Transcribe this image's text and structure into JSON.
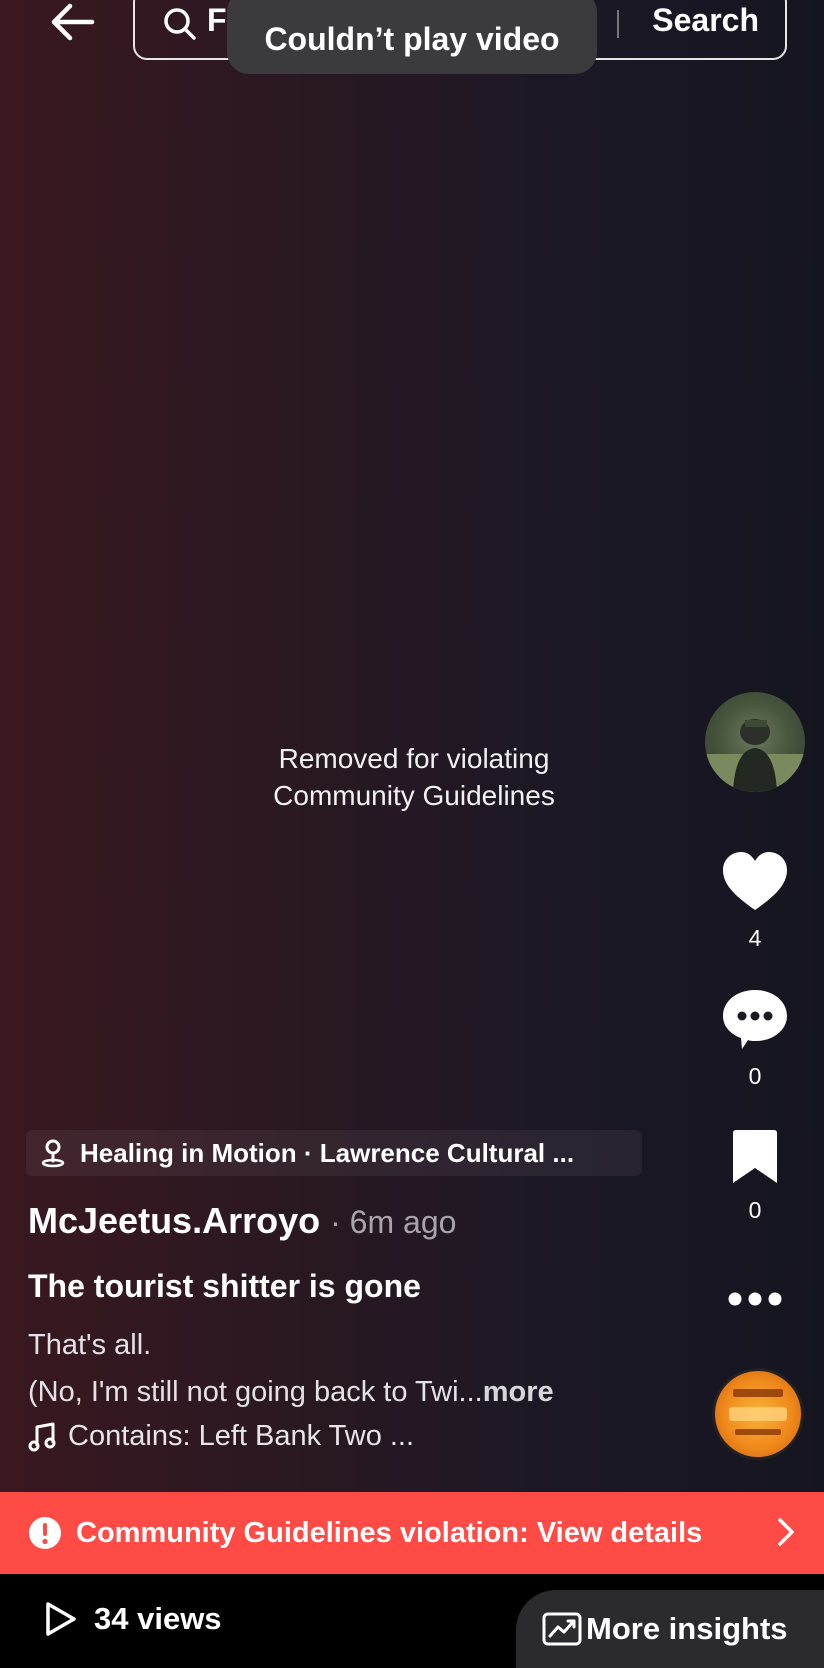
{
  "top_bar": {
    "search_query": "F",
    "search_label": "Search"
  },
  "toast": {
    "text": "Couldn’t play video"
  },
  "video": {
    "removed_line1": "Removed for violating",
    "removed_line2": "Community Guidelines"
  },
  "rail": {
    "likes": "4",
    "comments": "0",
    "saves": "0"
  },
  "post": {
    "location": "Healing in Motion · Lawrence Cultural ...",
    "author": "McJeetus.Arroyo",
    "time": "· 6m ago",
    "title": "The tourist shitter is gone",
    "body_line1": "That's all.",
    "body_line2": "(No, I'm still not going back to Twi...",
    "more_label": "more",
    "sound": "Contains: Left Bank Two ..."
  },
  "violation": {
    "text": "Community Guidelines violation: View details"
  },
  "bottom": {
    "views": "34 views",
    "insights": "More insights"
  },
  "colors": {
    "violation_red": "#fe4b46",
    "insights_bg": "#2b2b2d"
  }
}
